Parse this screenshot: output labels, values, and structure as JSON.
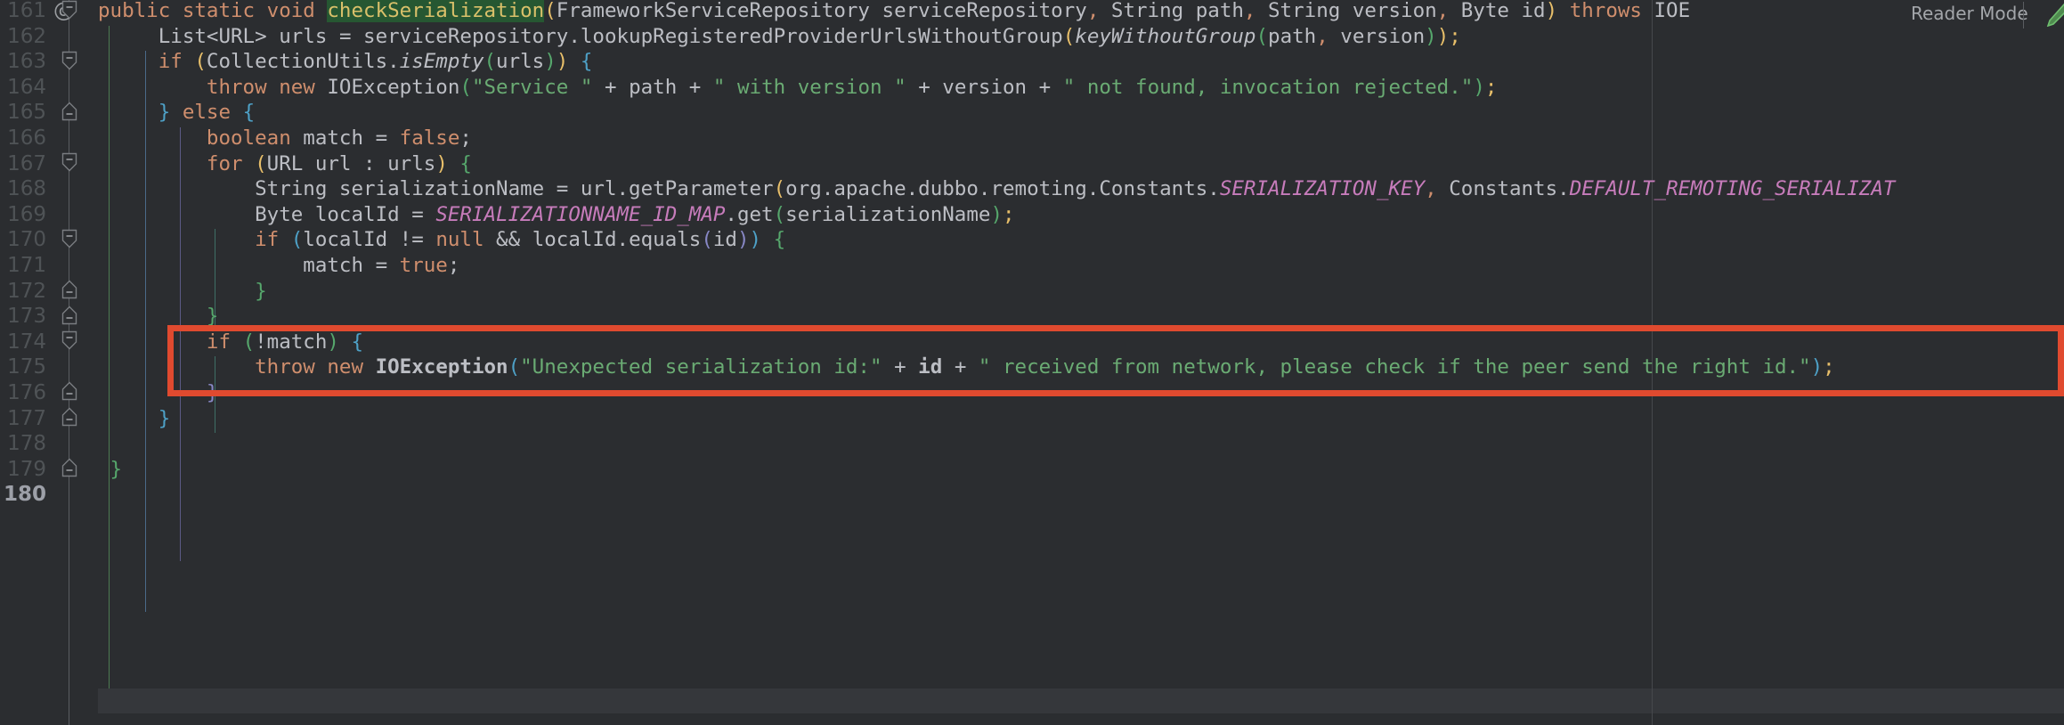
{
  "editor": {
    "file_language": "java",
    "first_visible_line": 161,
    "last_visible_line": 180,
    "current_line": 180,
    "annotation_color": "#e04a2f",
    "background": "#2b2d30",
    "gutter_color": "#4f5356"
  },
  "reader_mode": {
    "label": "Reader Mode",
    "pencil_icon": "pencil-icon",
    "pencil_color": "#5a9e5a"
  },
  "gutter": {
    "annotation_marker": "@",
    "line_numbers": [
      161,
      162,
      163,
      164,
      165,
      166,
      167,
      168,
      169,
      170,
      171,
      172,
      173,
      174,
      175,
      176,
      177,
      178,
      179,
      180
    ],
    "fold_markers": [
      {
        "line": 161,
        "type": "expanded-start"
      },
      {
        "line": 163,
        "type": "expanded-start"
      },
      {
        "line": 165,
        "type": "expanded-end"
      },
      {
        "line": 167,
        "type": "expanded-start"
      },
      {
        "line": 170,
        "type": "expanded-start"
      },
      {
        "line": 172,
        "type": "expanded-end"
      },
      {
        "line": 173,
        "type": "expanded-end"
      },
      {
        "line": 174,
        "type": "expanded-start"
      },
      {
        "line": 176,
        "type": "expanded-end"
      },
      {
        "line": 177,
        "type": "expanded-end"
      },
      {
        "line": 179,
        "type": "expanded-end"
      }
    ]
  },
  "lines": {
    "l161": "public static void checkSerialization(FrameworkServiceRepository serviceRepository, String path, String version, Byte id) throws IOE",
    "l162": "List<URL> urls = serviceRepository.lookupRegisteredProviderUrlsWithoutGroup(keyWithoutGroup(path, version));",
    "l163": "if (CollectionUtils.isEmpty(urls)) {",
    "l164": "throw new IOException(\"Service \" + path + \" with version \" + version + \" not found, invocation rejected.\");",
    "l165": "} else {",
    "l166": "boolean match = false;",
    "l167": "for (URL url : urls) {",
    "l168": "String serializationName = url.getParameter(org.apache.dubbo.remoting.Constants.SERIALIZATION_KEY, Constants.DEFAULT_REMOTING_SERIALIZAT",
    "l169": "Byte localId = SERIALIZATIONNAME_ID_MAP.get(serializationName);",
    "l170": "if (localId != null && localId.equals(id)) {",
    "l171": "match = true;",
    "l172": "}",
    "l173": "}",
    "l174": "if (!match) {",
    "l175": "throw new IOException(\"Unexpected serialization id:\" + id + \" received from network, please check if the peer send the right id.\");",
    "l176": "}",
    "l177": "}",
    "l178": "",
    "l179": "}",
    "l180": ""
  },
  "highlighted_identifier": "checkSerialization",
  "annotation_box": {
    "covers_lines": [
      174,
      175,
      176
    ],
    "note": "red rectangle drawn around the !match throw block"
  }
}
